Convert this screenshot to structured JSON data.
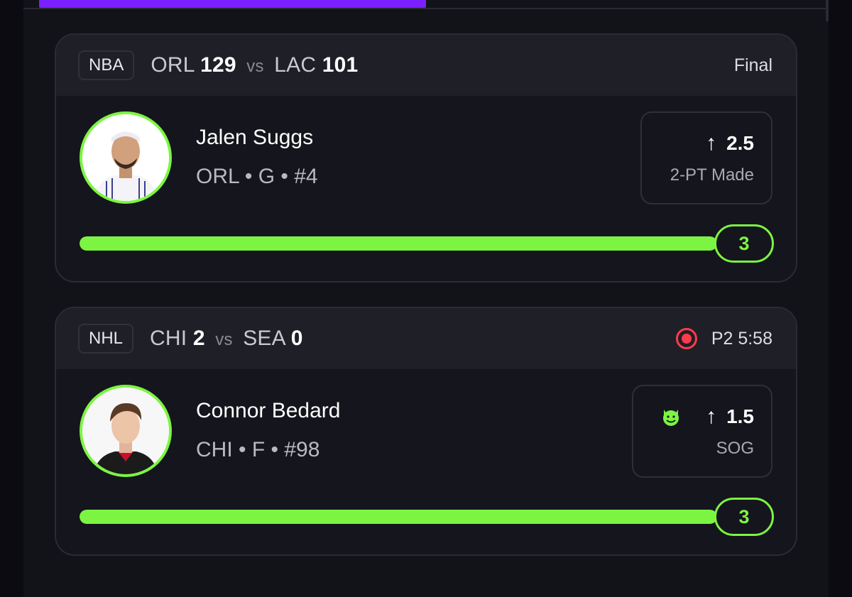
{
  "colors": {
    "accent": "#7cf542",
    "live": "#ff3b4a",
    "progress": "#7a1fff"
  },
  "cards": [
    {
      "league": "NBA",
      "home_team": "ORL",
      "home_score": "129",
      "vs": "vs",
      "away_team": "LAC",
      "away_score": "101",
      "status": "Final",
      "player_name": "Jalen Suggs",
      "player_meta": "ORL • G • #4",
      "pick_direction_icon": "arrow-up-icon",
      "pick_line": "2.5",
      "pick_stat": "2-PT Made",
      "progress_value": "3",
      "progress_fraction": 1.0
    },
    {
      "league": "NHL",
      "home_team": "CHI",
      "home_score": "2",
      "vs": "vs",
      "away_team": "SEA",
      "away_score": "0",
      "status": "P2 5:58",
      "status_icon": "live-icon",
      "player_name": "Connor Bedard",
      "player_meta": "CHI • F • #98",
      "pick_badge_icon": "devil-emoji-icon",
      "pick_direction_icon": "arrow-up-icon",
      "pick_line": "1.5",
      "pick_stat": "SOG",
      "progress_value": "3",
      "progress_fraction": 1.0
    }
  ]
}
